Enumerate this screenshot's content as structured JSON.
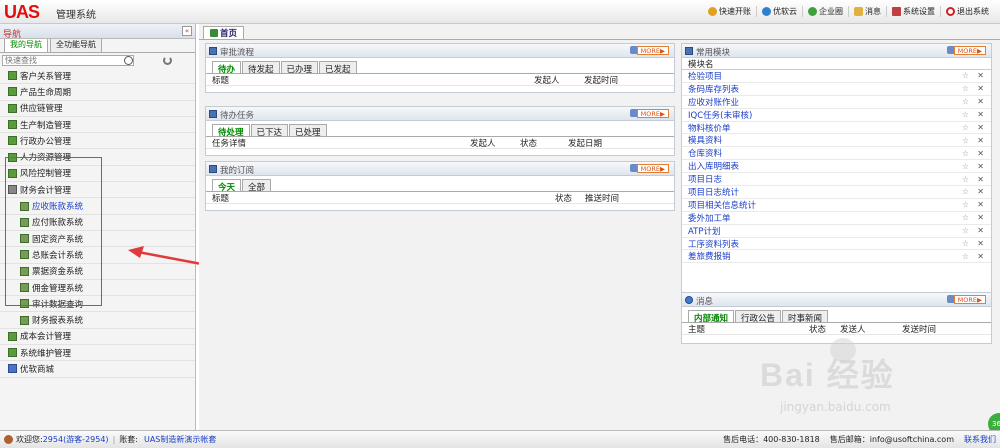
{
  "app": {
    "logo": "UAS",
    "title": "管理系统"
  },
  "topnav": [
    {
      "label": "快速开账",
      "icon": "quick-account-icon",
      "color": "#e0a020"
    },
    {
      "label": "优软云",
      "icon": "cloud-icon",
      "color": "#3080d0"
    },
    {
      "label": "企业圈",
      "icon": "circle-icon",
      "color": "#40a040"
    },
    {
      "label": "消息",
      "icon": "message-icon",
      "color": "#e0b040"
    },
    {
      "label": "系统设置",
      "icon": "settings-icon",
      "color": "#c04040"
    },
    {
      "label": "退出系统",
      "icon": "power-icon",
      "color": "#d02020"
    }
  ],
  "sidebar": {
    "title": "导航",
    "collapse": "«",
    "tabs": [
      "我的导航",
      "全功能导航"
    ],
    "search_placeholder": "快速查找",
    "items": [
      {
        "label": "客户关系管理",
        "type": "top"
      },
      {
        "label": "产品生命周期",
        "type": "top"
      },
      {
        "label": "供应链管理",
        "type": "top"
      },
      {
        "label": "生产制造管理",
        "type": "top"
      },
      {
        "label": "行政办公管理",
        "type": "top"
      },
      {
        "label": "人力资源管理",
        "type": "top"
      },
      {
        "label": "风险控制管理",
        "type": "top"
      },
      {
        "label": "财务会计管理",
        "type": "open"
      },
      {
        "label": "应收账款系统",
        "type": "sub-active"
      },
      {
        "label": "应付账款系统",
        "type": "sub"
      },
      {
        "label": "固定资产系统",
        "type": "sub"
      },
      {
        "label": "总账会计系统",
        "type": "sub"
      },
      {
        "label": "票据资金系统",
        "type": "sub"
      },
      {
        "label": "佣金管理系统",
        "type": "sub"
      },
      {
        "label": "审计数据查询",
        "type": "sub"
      },
      {
        "label": "财务报表系统",
        "type": "sub"
      },
      {
        "label": "成本会计管理",
        "type": "top"
      },
      {
        "label": "系统维护管理",
        "type": "top"
      },
      {
        "label": "优软商城",
        "type": "top"
      }
    ]
  },
  "main": {
    "tab": "首页",
    "more_label": "MORE▶",
    "approval": {
      "title": "审批流程",
      "tabs": [
        "待办",
        "待发起",
        "已办理",
        "已发起"
      ],
      "columns": [
        "标题",
        "发起人",
        "发起时间"
      ]
    },
    "tasks": {
      "title": "待办任务",
      "tabs": [
        "待处理",
        "已下达",
        "已处理"
      ],
      "columns": [
        "任务详情",
        "发起人",
        "状态",
        "发起日期"
      ]
    },
    "subscriptions": {
      "title": "我的订阅",
      "tabs": [
        "今天",
        "全部"
      ],
      "columns": [
        "标题",
        "状态",
        "推送时间"
      ]
    },
    "modules": {
      "title": "常用模块",
      "header": "模块名",
      "items": [
        "检验项目",
        "条码库存列表",
        "应收对账作业",
        "IQC任务(未审核)",
        "物料核价单",
        "模具资料",
        "仓库资料",
        "出入库明细表",
        "项目日志",
        "项目日志统计",
        "项目相关信息统计",
        "委外加工单",
        "ATP计划",
        "工序资料列表",
        "差旅费报销"
      ]
    },
    "messages": {
      "title": "消息",
      "tabs": [
        "内部通知",
        "行政公告",
        "时事新闻"
      ],
      "columns": [
        "主题",
        "状态",
        "发送人",
        "发送时间"
      ]
    }
  },
  "statusbar": {
    "welcome": "欢迎您:",
    "user": "2954(游客-2954)",
    "account_label": "账套:",
    "account": "UAS制造新演示帐套",
    "phone_label": "售后电话：400-830-1818",
    "email_label": "售后邮箱：info@usoftchina.com",
    "contact": "联系我们"
  },
  "watermark": {
    "text": "Bai 经验",
    "url": "jingyan.baidu.com",
    "badge": "36"
  },
  "colors": {
    "accent": "#1a3ec8",
    "highlight": "#e23a3a",
    "green": "#5a9b3c"
  }
}
